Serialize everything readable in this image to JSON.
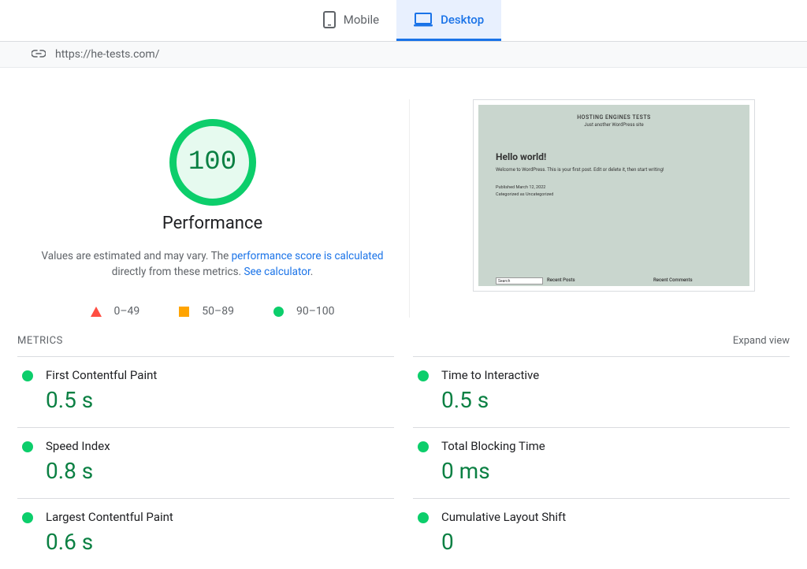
{
  "tabs": {
    "mobile": "Mobile",
    "desktop": "Desktop"
  },
  "url": "https://he-tests.com/",
  "score": {
    "value": "100",
    "title": "Performance"
  },
  "description": {
    "prefix": "Values are estimated and may vary. The ",
    "link1": "performance score is calculated",
    "middle": " directly from these metrics. ",
    "link2": "See calculator",
    "suffix": "."
  },
  "legend": {
    "low": "0–49",
    "mid": "50–89",
    "high": "90–100"
  },
  "preview": {
    "title": "HOSTING ENGINES TESTS",
    "subtitle": "Just another WordPress site",
    "heading": "Hello world!",
    "body": "Welcome to WordPress. This is your first post. Edit or delete it, then start writing!",
    "meta1": "Published March 12, 2022",
    "meta2": "Categorized as Uncategorized",
    "search": "Search",
    "recent_posts": "Recent Posts",
    "recent_comments": "Recent Comments"
  },
  "metricsHeader": {
    "title": "METRICS",
    "expand": "Expand view"
  },
  "metrics": [
    {
      "label": "First Contentful Paint",
      "value": "0.5 s"
    },
    {
      "label": "Time to Interactive",
      "value": "0.5 s"
    },
    {
      "label": "Speed Index",
      "value": "0.8 s"
    },
    {
      "label": "Total Blocking Time",
      "value": "0 ms"
    },
    {
      "label": "Largest Contentful Paint",
      "value": "0.6 s"
    },
    {
      "label": "Cumulative Layout Shift",
      "value": "0"
    }
  ]
}
